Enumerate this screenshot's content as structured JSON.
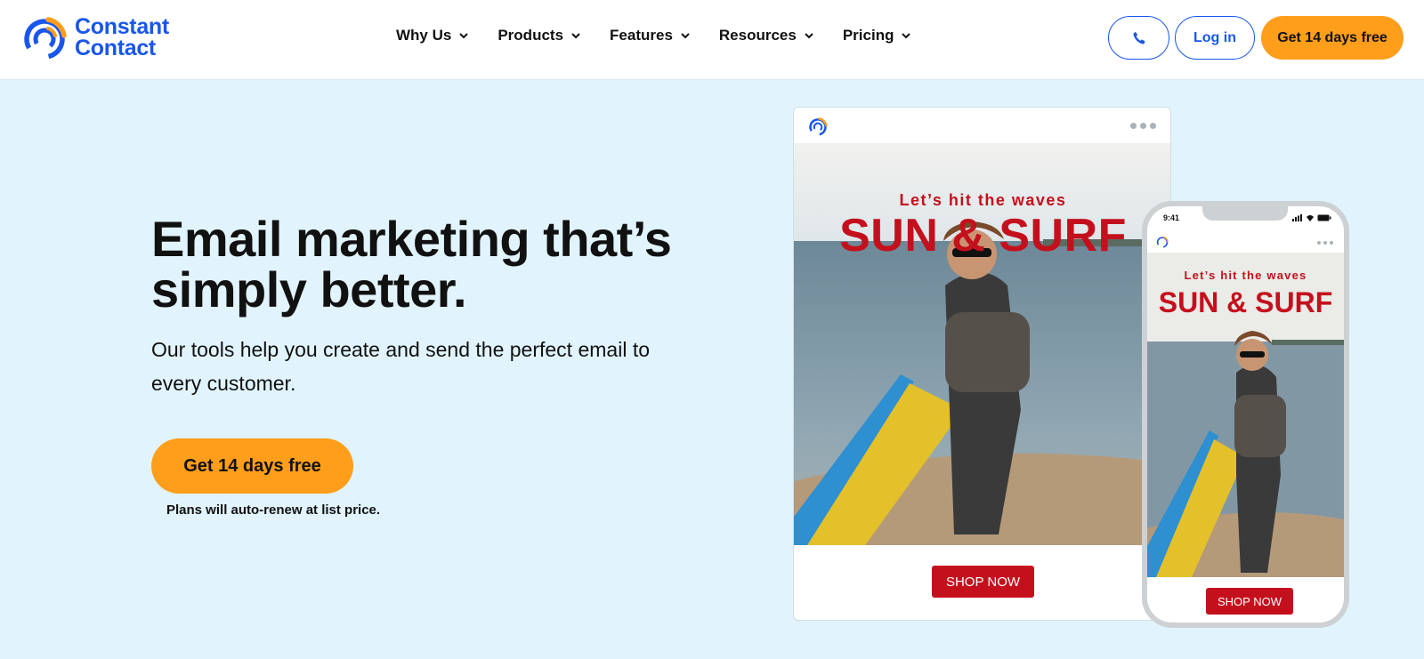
{
  "header": {
    "logo": {
      "line1": "Constant",
      "line2": "Contact",
      "icon": "constant-contact-logo-icon"
    },
    "nav": [
      {
        "label": "Why Us",
        "icon": "chevron-down-icon"
      },
      {
        "label": "Products",
        "icon": "chevron-down-icon"
      },
      {
        "label": "Features",
        "icon": "chevron-down-icon"
      },
      {
        "label": "Resources",
        "icon": "chevron-down-icon"
      },
      {
        "label": "Pricing",
        "icon": "chevron-down-icon"
      }
    ],
    "phone_icon": "phone-icon",
    "login_label": "Log in",
    "trial_label": "Get 14 days free"
  },
  "hero": {
    "title": "Email marketing that’s simply better.",
    "subtitle": "Our tools help you create and send the perfect email to every customer.",
    "cta_label": "Get 14 days free",
    "note": "Plans will auto-renew at list price."
  },
  "desktop_preview": {
    "tagline": "Let’s hit the waves",
    "headline": "SUN & SURF",
    "button": "SHOP NOW",
    "image": "surfer-photo"
  },
  "phone_preview": {
    "time": "9:41",
    "tagline": "Let’s hit the waves",
    "headline": "SUN & SURF",
    "button": "SHOP NOW",
    "image": "surfer-photo"
  },
  "colors": {
    "brand_blue": "#1856ed",
    "brand_orange": "#ff9e1b",
    "hero_bg": "#e1f4fd",
    "email_red": "#c4101d"
  }
}
